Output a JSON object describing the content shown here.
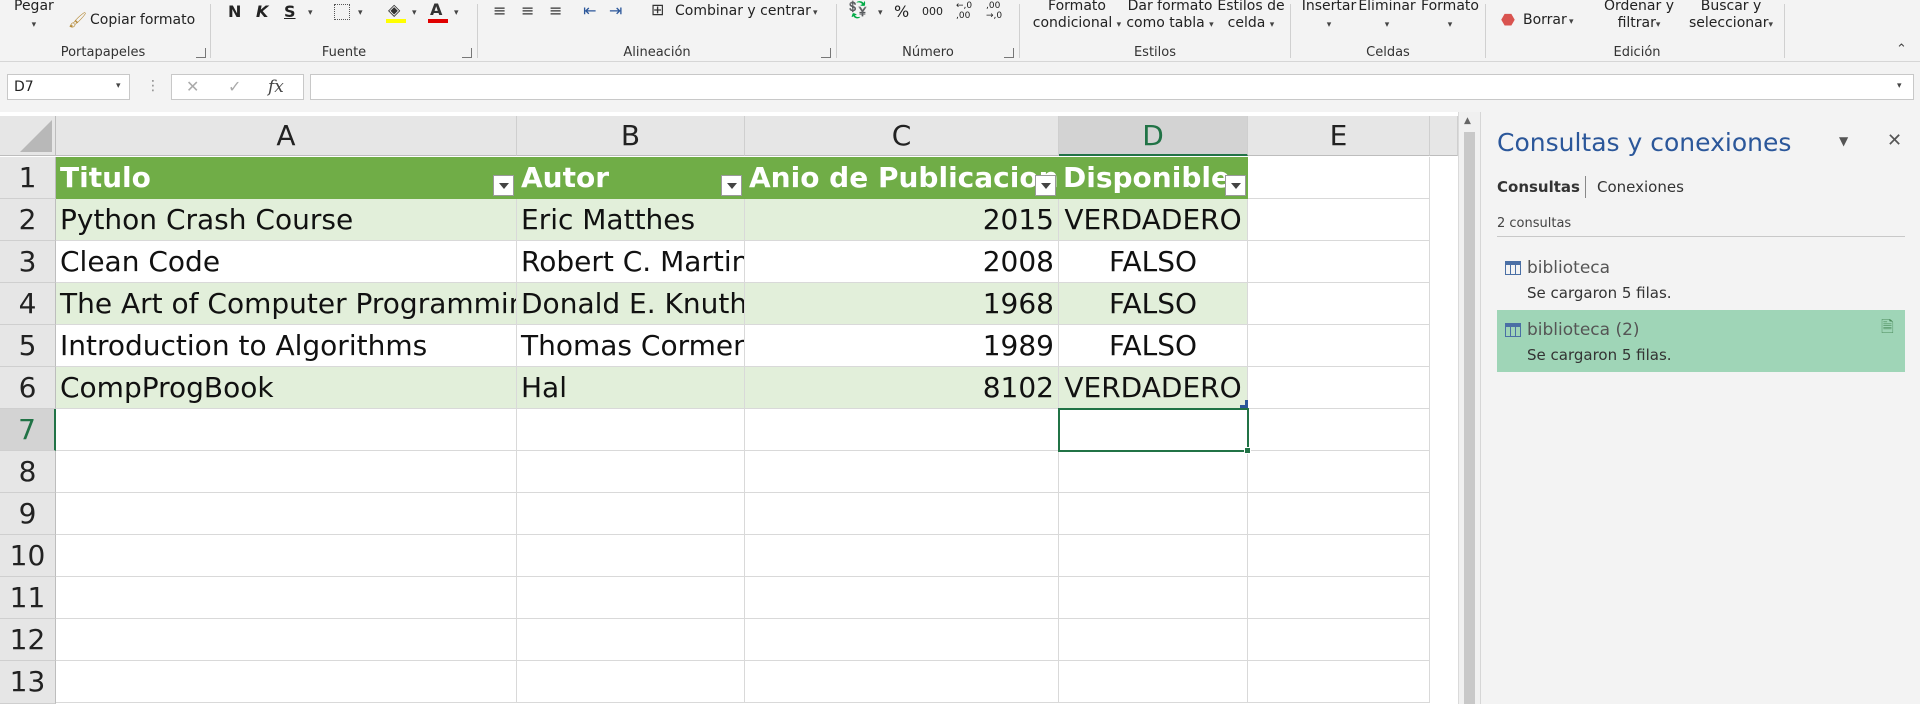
{
  "ribbon": {
    "clipboard": {
      "paste": "Pegar",
      "copy_format": "Copiar formato",
      "group": "Portapapeles"
    },
    "font": {
      "bold": "N",
      "italic": "K",
      "underline": "S",
      "group": "Fuente"
    },
    "alignment": {
      "merge_center": "Combinar y centrar",
      "group": "Alineación"
    },
    "number": {
      "percent": "%",
      "thousands": "000",
      "inc_decimal": "←,0 ,00",
      "dec_decimal": ",00 →,0",
      "group": "Número"
    },
    "styles": {
      "conditional_line1": "Formato",
      "conditional_line2": "condicional",
      "table_line1": "Dar formato",
      "table_line2": "como tabla",
      "cell_line1": "Estilos de",
      "cell_line2": "celda",
      "group": "Estilos"
    },
    "cells": {
      "insert": "Insertar",
      "delete": "Eliminar",
      "format": "Formato",
      "group": "Celdas"
    },
    "editing": {
      "clear": "Borrar",
      "sort_line1": "Ordenar y",
      "sort_line2": "filtrar",
      "find_line1": "Buscar y",
      "find_line2": "seleccionar",
      "group": "Edición"
    }
  },
  "formula_bar": {
    "name_box": "D7",
    "fx": "fx",
    "cancel": "✕",
    "enter": "✓",
    "value": ""
  },
  "sheet": {
    "columns": [
      "A",
      "B",
      "C",
      "D",
      "E"
    ],
    "rows": [
      "1",
      "2",
      "3",
      "4",
      "5",
      "6",
      "7",
      "8",
      "9",
      "10",
      "11",
      "12",
      "13"
    ],
    "headers": [
      "Titulo",
      "Autor",
      "Anio de Publicacion",
      "Disponible"
    ],
    "data": [
      [
        "Python Crash Course",
        "Eric Matthes",
        "2015",
        "VERDADERO"
      ],
      [
        "Clean Code",
        "Robert C. Martin",
        "2008",
        "FALSO"
      ],
      [
        "The Art of Computer Programming",
        "Donald E. Knuth",
        "1968",
        "FALSO"
      ],
      [
        "Introduction to Algorithms",
        "Thomas Cormen",
        "1989",
        "FALSO"
      ],
      [
        "CompProgBook",
        "Hal",
        "8102",
        "VERDADERO"
      ]
    ],
    "selected_cell": "D7"
  },
  "pane": {
    "title": "Consultas y conexiones",
    "tab_queries": "Consultas",
    "tab_connections": "Conexiones",
    "count": "2 consultas",
    "queries": [
      {
        "name": "biblioteca",
        "status": "Se cargaron 5 filas."
      },
      {
        "name": "biblioteca (2)",
        "status": "Se cargaron 5 filas."
      }
    ]
  },
  "colors": {
    "table_header": "#70ad47",
    "band": "#e2efda",
    "selection": "#217346",
    "query_selected": "#9fd5b7"
  }
}
